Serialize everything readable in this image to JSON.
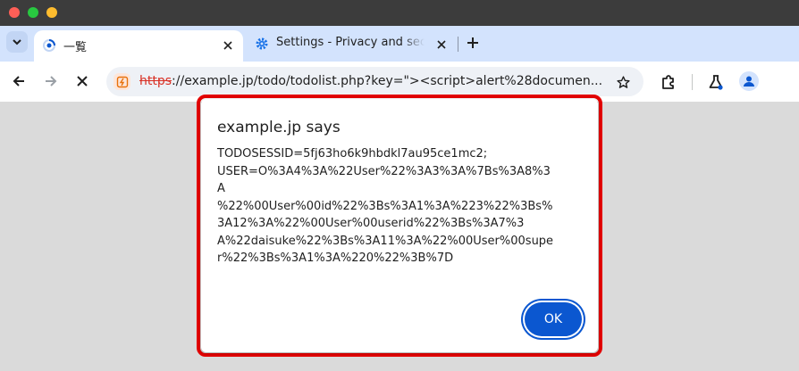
{
  "window": {
    "controls": [
      "close",
      "minimize",
      "maximize"
    ]
  },
  "tabs": [
    {
      "title": "一覧",
      "active": true,
      "favicon": "loading-favicon-icon"
    },
    {
      "title": "Settings - Privacy and security",
      "active": false,
      "favicon": "settings-gear-icon"
    }
  ],
  "omnibox": {
    "scheme": "https",
    "rest": "://example.jp/todo/todolist.php?key=\"><script>alert%28documen..."
  },
  "dialog": {
    "title": "example.jp says",
    "message": "TODOSESSID=5fj63ho6k9hbdkl7au95ce1mc2;\nUSER=O%3A4%3A%22User%22%3A3%3A%7Bs%3A8%3\nA\n%22%00User%00id%22%3Bs%3A1%3A%223%22%3Bs%\n3A12%3A%22%00User%00userid%22%3Bs%3A7%3\nA%22daisuke%22%3Bs%3A11%3A%22%00User%00supe\nr%22%3Bs%3A1%3A%220%22%3B%7D",
    "ok_label": "OK"
  },
  "colors": {
    "highlight": "#e30000",
    "primary": "#0b57d0",
    "tabstrip": "#d3e3fd",
    "page_background": "#dadada"
  }
}
